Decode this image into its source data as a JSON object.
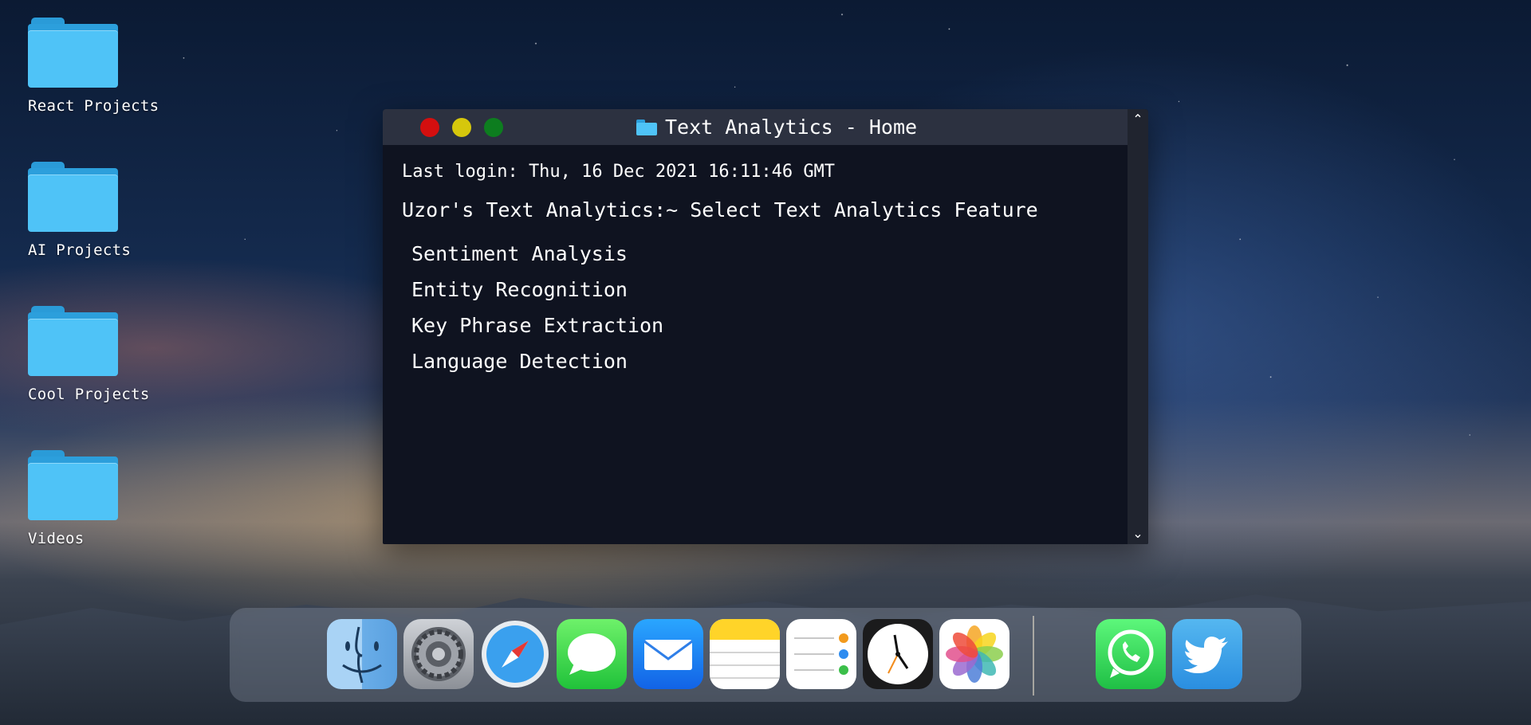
{
  "desktop": {
    "folders": [
      {
        "label": "React Projects"
      },
      {
        "label": "AI Projects"
      },
      {
        "label": "Cool Projects"
      },
      {
        "label": "Videos"
      }
    ]
  },
  "terminal": {
    "title": "Text Analytics - Home",
    "last_login": "Last login: Thu, 16 Dec 2021 16:11:46 GMT",
    "prompt": "Uzor's Text Analytics:~ Select Text Analytics Feature",
    "menu": [
      {
        "label": "Sentiment Analysis"
      },
      {
        "label": "Entity Recognition"
      },
      {
        "label": "Key Phrase Extraction"
      },
      {
        "label": "Language Detection"
      }
    ],
    "traffic_lights": {
      "close": "#d40f0f",
      "minimize": "#d6c70c",
      "maximize": "#0d7d1f"
    }
  },
  "dock": {
    "apps": [
      {
        "icon": "finder-icon"
      },
      {
        "icon": "system-preferences-icon"
      },
      {
        "icon": "safari-icon"
      },
      {
        "icon": "messages-icon"
      },
      {
        "icon": "mail-icon"
      },
      {
        "icon": "notes-icon"
      },
      {
        "icon": "reminders-icon"
      },
      {
        "icon": "clock-icon"
      },
      {
        "icon": "photos-icon"
      },
      {
        "icon": "whatsapp-icon"
      },
      {
        "icon": "twitter-icon"
      }
    ]
  },
  "colors": {
    "terminal_bg": "#0f1320",
    "titlebar_bg": "#2c3140",
    "folder_blue": "#4fc3f7"
  }
}
